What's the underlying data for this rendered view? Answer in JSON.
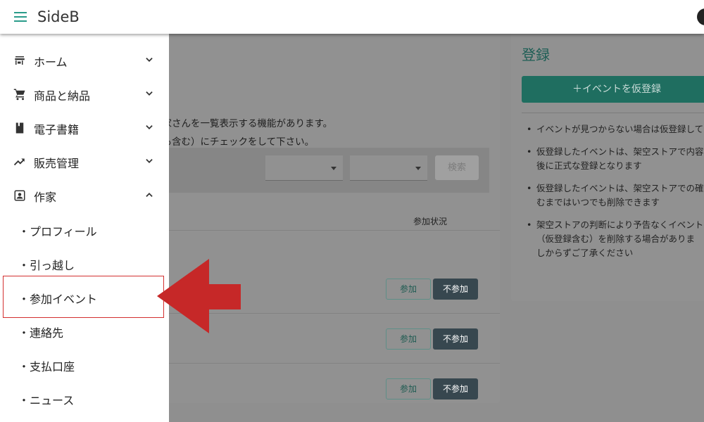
{
  "app": {
    "title": "SideB"
  },
  "nav": {
    "items": [
      {
        "label": "ホーム",
        "icon": "store-icon",
        "expanded": false
      },
      {
        "label": "商品と納品",
        "icon": "cart-icon",
        "expanded": false
      },
      {
        "label": "電子書籍",
        "icon": "book-icon",
        "expanded": false
      },
      {
        "label": "販売管理",
        "icon": "trending-up-icon",
        "expanded": false
      },
      {
        "label": "作家",
        "icon": "account-box-icon",
        "expanded": true
      }
    ],
    "sub_items": [
      {
        "label": "・プロフィール"
      },
      {
        "label": "・引っ越し"
      },
      {
        "label": "・参加イベント",
        "highlighted": true
      },
      {
        "label": "・連絡先"
      },
      {
        "label": "・支払口座"
      },
      {
        "label": "・ニュース"
      }
    ]
  },
  "main": {
    "intro_line1": "参加作家さんを一覧表示する機能があります。",
    "intro_line2": "加予定も含む）にチェックをして下さい。",
    "search_label": "検索",
    "column_header": "参加状況",
    "rows": [
      {
        "join_label": "参加",
        "decline_label": "不参加"
      },
      {
        "join_label": "参加",
        "decline_label": "不参加"
      },
      {
        "join_label": "参加",
        "decline_label": "不参加"
      }
    ]
  },
  "register": {
    "title": "登録",
    "button_label": "＋イベントを仮登録",
    "notes": [
      "イベントが見つからない場合は仮登録して",
      "仮登録したイベントは、架空ストアで内容\n後に正式な登録となります",
      "仮登録したイベントは、架空ストアでの確\nむまではいつでも削除できます",
      "架空ストアの判断により予告なくイベント\n（仮登録含む）を削除する場合がありま\nしからずご了承ください"
    ]
  },
  "colors": {
    "accent": "#2a9b8a",
    "arrow": "#c62828",
    "highlight_border": "#d32f2f"
  }
}
